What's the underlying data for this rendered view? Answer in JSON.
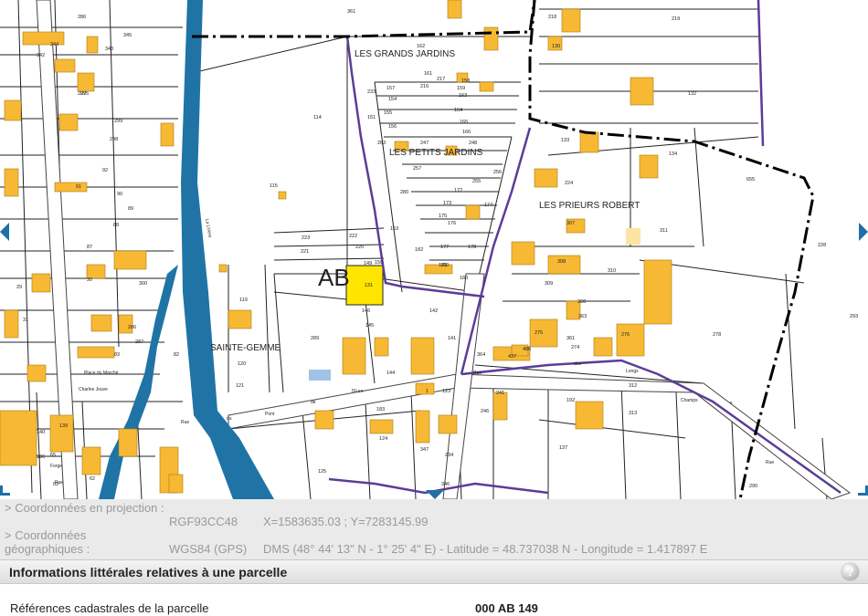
{
  "map": {
    "section_label": "AB",
    "place_names": [
      "LES GRANDS JARDINS",
      "LES PETITS JARDINS",
      "LES PRIEURS ROBERT",
      "SAINTE-GEMME"
    ],
    "street_labels": [
      "Place du Marché",
      "Charles Jouve",
      "Rue",
      "du",
      "Pont",
      "de",
      "l'Eure",
      "Rue",
      "des",
      "Longs",
      "Champs",
      "Rue",
      "Forge",
      "Rue",
      "La Lirière"
    ],
    "parcel_numbers": [
      "286",
      "361",
      "345",
      "344",
      "343",
      "342",
      "207",
      "299",
      "298",
      "92",
      "91",
      "90",
      "89",
      "88",
      "87",
      "30",
      "29",
      "31",
      "295",
      "300",
      "286",
      "287",
      "83",
      "82",
      "115",
      "114",
      "119",
      "120",
      "121",
      "131",
      "223",
      "222",
      "221",
      "220",
      "150",
      "149",
      "146",
      "145",
      "144",
      "142",
      "141",
      "289",
      "153",
      "163",
      "164",
      "165",
      "166",
      "247",
      "248",
      "257",
      "256",
      "255",
      "280",
      "172",
      "173",
      "174",
      "175",
      "176",
      "177",
      "178",
      "179",
      "180",
      "182",
      "183",
      "1",
      "123",
      "124",
      "347",
      "234",
      "125",
      "346",
      "233",
      "263",
      "151",
      "154",
      "155",
      "156",
      "157",
      "158",
      "159",
      "160",
      "161",
      "162",
      "216",
      "217",
      "218",
      "219",
      "130",
      "132",
      "133",
      "134",
      "655",
      "224",
      "307",
      "311",
      "308",
      "310",
      "309",
      "360",
      "363",
      "361",
      "274",
      "275",
      "276",
      "278",
      "293",
      "228",
      "364",
      "437",
      "486",
      "192",
      "312",
      "313",
      "137",
      "241",
      "246",
      "290",
      "139",
      "140",
      "586",
      "63",
      "65",
      "62",
      "57",
      "49",
      "56",
      "348"
    ],
    "colors": {
      "building": "#f7b934",
      "building_light": "#fde3a4",
      "selected_parcel": "#ffe500",
      "river": "#1f74a5",
      "boundary_purple": "#5b3d96",
      "parcel_line": "#222222",
      "pond": "#9ec3e6"
    },
    "nav_icons": [
      "arrow-left-icon",
      "arrow-right-icon",
      "arrow-down-icon"
    ]
  },
  "coords": {
    "projection": {
      "label": "> Coordonnées en projection :",
      "system": "RGF93CC48",
      "value": "X=1583635.03 ; Y=7283145.99"
    },
    "geographic": {
      "label": "> Coordonnées géographiques :",
      "system": "WGS84 (GPS)",
      "value": "DMS (48° 44' 13\" N - 1° 25' 4\" E) - Latitude = 48.737038 N - Longitude = 1.417897 E"
    }
  },
  "info": {
    "title": "Informations littérales relatives à une parcelle",
    "help_icon": "help-icon",
    "help_glyph": "?",
    "ref_label": "Références cadastrales de la parcelle",
    "ref_value": "000 AB 149"
  }
}
